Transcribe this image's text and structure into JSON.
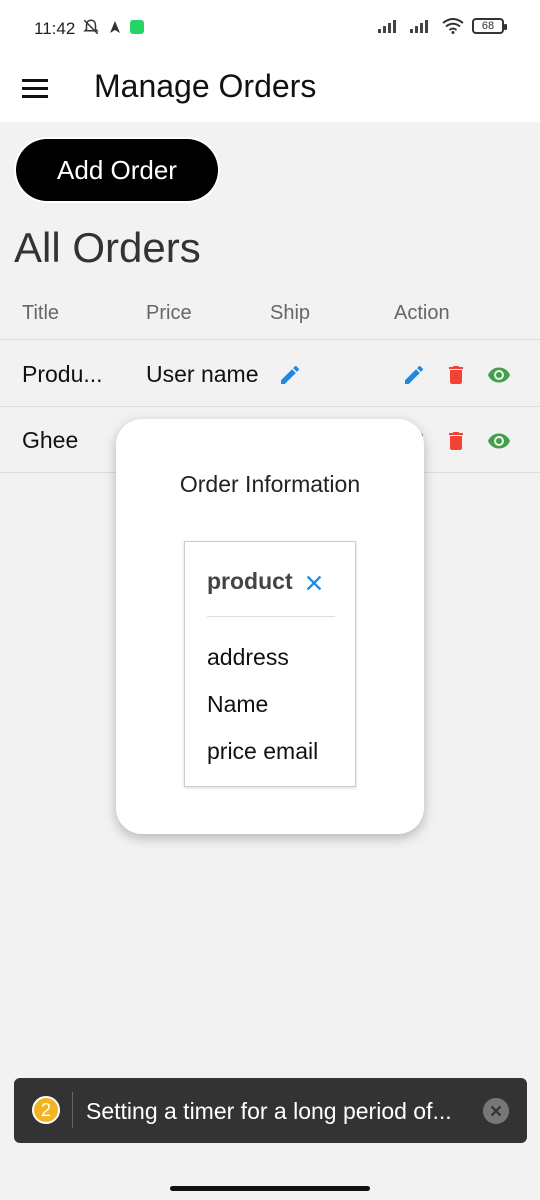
{
  "status": {
    "time": "11:42",
    "battery": "68"
  },
  "appbar": {
    "title": "Manage Orders"
  },
  "add_button": {
    "label": "Add Order"
  },
  "section_title": "All Orders",
  "table": {
    "headers": [
      "Title",
      "Price",
      "Ship",
      "Action"
    ],
    "rows": [
      {
        "title": "Produ...",
        "price": "User name"
      },
      {
        "title": "Ghee",
        "price": ""
      }
    ]
  },
  "modal": {
    "title": "Order Information",
    "product_label": "product",
    "items": [
      "address",
      "Name",
      "price email"
    ]
  },
  "toast": {
    "count": "2",
    "message": "Setting a timer for a long period of..."
  },
  "colors": {
    "edit": "#1e88e5",
    "delete": "#f44336",
    "view": "#43a047"
  }
}
